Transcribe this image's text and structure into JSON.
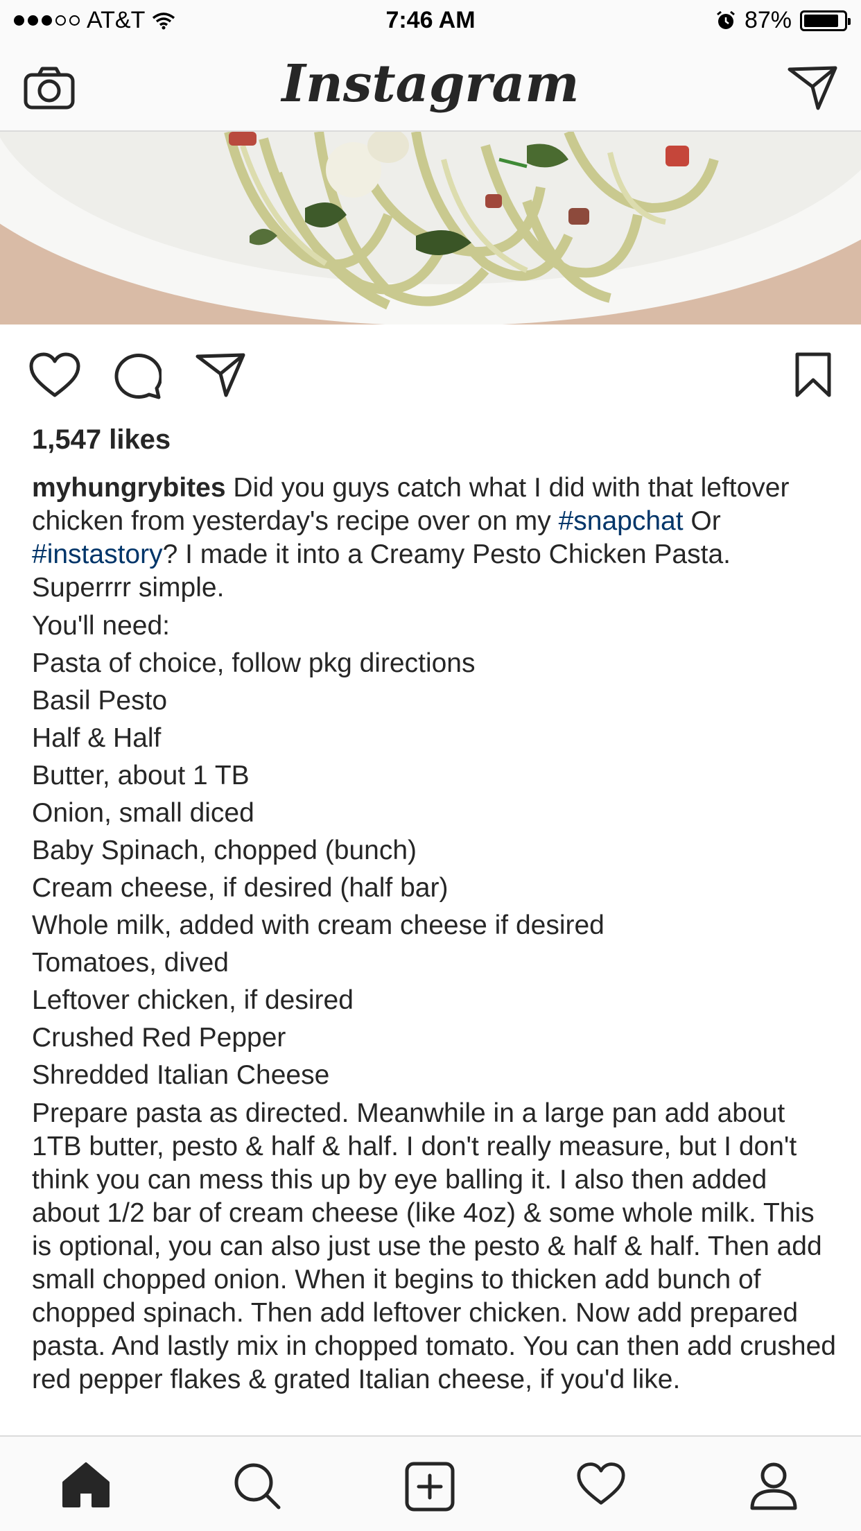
{
  "status_bar": {
    "carrier": "AT&T",
    "time": "7:46 AM",
    "battery_text": "87%",
    "battery_level": 0.87,
    "signal_bars_filled": 3,
    "signal_bars_total": 5
  },
  "nav": {
    "title": "Instagram",
    "left_icon": "camera-icon",
    "right_icon": "direct-message-icon"
  },
  "post": {
    "likes": "1,547 likes",
    "username": "myhungrybites",
    "caption_intro_1": "Did you guys catch what I did with that leftover chicken from yesterday's recipe over on my",
    "hashtag_1": "#snapchat",
    "caption_intro_2": "Or",
    "hashtag_2": "#instastory",
    "caption_intro_3": "? I made it into a Creamy Pesto Chicken Pasta. Superrrr simple.",
    "ingredients_header": "You'll need:",
    "ingredients": [
      "Pasta of choice, follow pkg directions",
      "Basil Pesto",
      "Half & Half",
      "Butter, about 1 TB",
      "Onion, small diced",
      "Baby Spinach, chopped (bunch)",
      "Cream cheese, if desired (half bar)",
      "Whole milk, added with cream cheese if desired",
      "Tomatoes, dived",
      "Leftover chicken, if desired",
      "Crushed Red Pepper",
      "Shredded Italian Cheese"
    ],
    "directions": "Prepare pasta as directed. Meanwhile in a large pan add about 1TB butter, pesto & half & half. I don't really measure, but I don't think you can mess this up by eye balling it. I also then added about 1/2 bar of cream cheese (like 4oz) & some whole milk. This is optional, you can also just use the pesto & half & half. Then add small chopped onion. When it begins to thicken add bunch of chopped spinach. Then add leftover chicken. Now add prepared pasta. And lastly mix in chopped tomato. You can then add crushed red pepper flakes & grated Italian cheese, if you'd like."
  },
  "actions": {
    "like": "heart-icon",
    "comment": "comment-icon",
    "share": "share-icon",
    "save": "bookmark-icon"
  },
  "tab_bar": [
    "home-icon",
    "search-icon",
    "add-post-icon",
    "activity-heart-icon",
    "profile-icon"
  ],
  "colors": {
    "text": "#262626",
    "hashtag": "#003569",
    "bar_background": "#fafafa",
    "divider": "#dbdbdb"
  }
}
